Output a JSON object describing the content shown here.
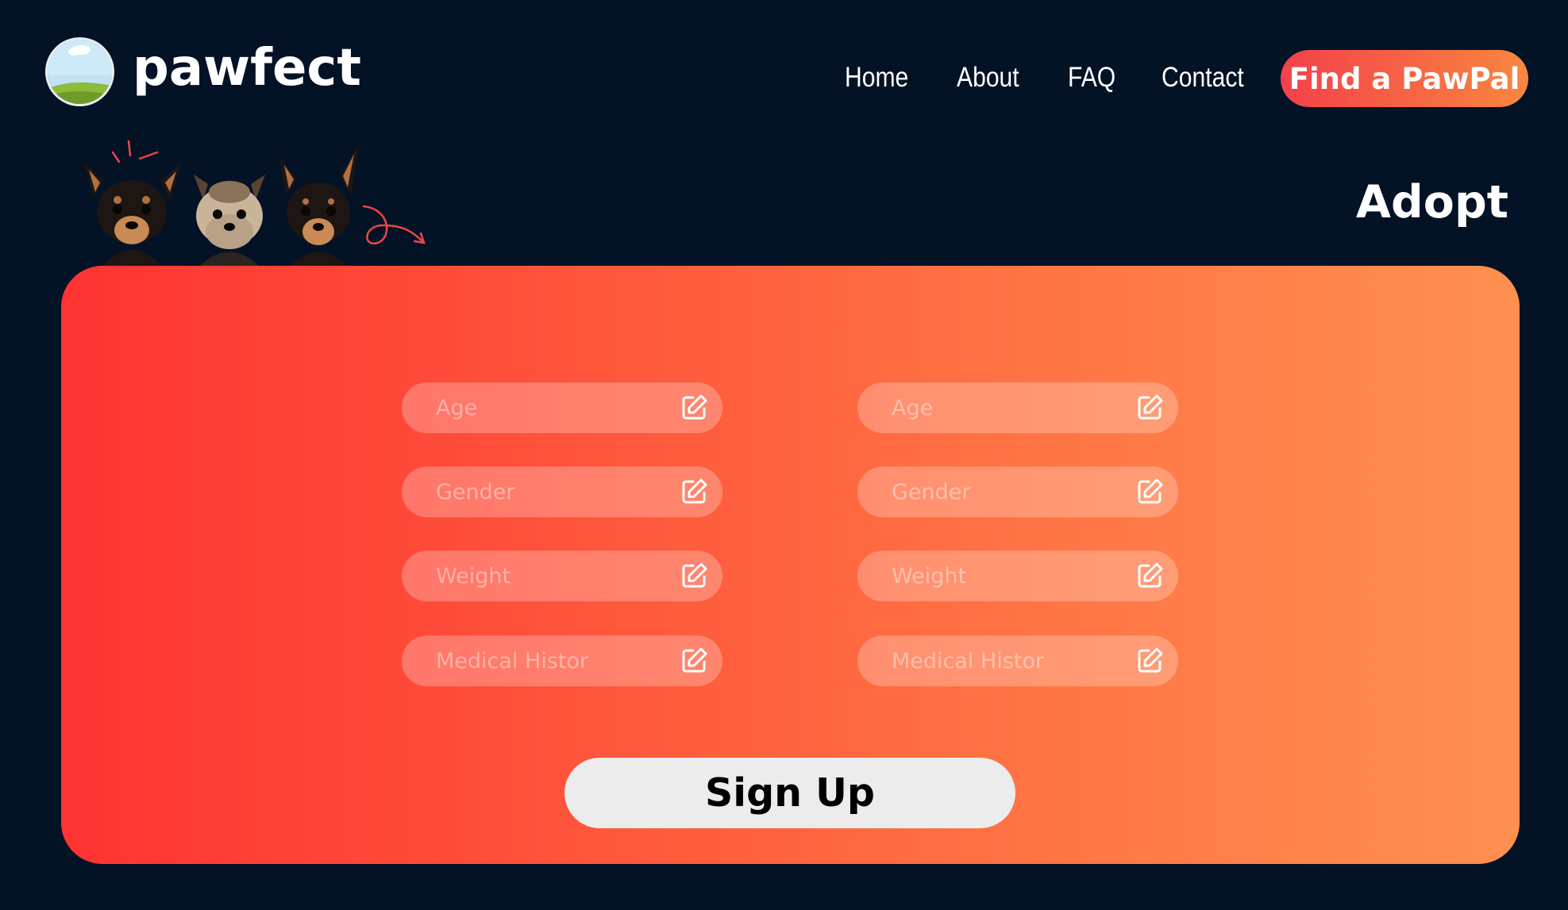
{
  "brand": {
    "name": "pawfect"
  },
  "nav": {
    "links": [
      "Home",
      "About",
      "FAQ",
      "Contact"
    ],
    "cta_label": "Find a PawPal"
  },
  "page": {
    "heading": "Adopt"
  },
  "form": {
    "columns": [
      {
        "fields": [
          {
            "placeholder": "Age",
            "value": ""
          },
          {
            "placeholder": "Gender",
            "value": ""
          },
          {
            "placeholder": "Weight",
            "value": ""
          },
          {
            "placeholder": "Medical Histor",
            "value": ""
          }
        ]
      },
      {
        "fields": [
          {
            "placeholder": "Age",
            "value": ""
          },
          {
            "placeholder": "Gender",
            "value": ""
          },
          {
            "placeholder": "Weight",
            "value": ""
          },
          {
            "placeholder": "Medical Histor",
            "value": ""
          }
        ]
      }
    ],
    "submit_label": "Sign Up"
  },
  "icons": {
    "field_action": "edit-icon",
    "logo": "landscape-icon"
  },
  "colors": {
    "background": "#041226",
    "panel_gradient_start": "#ff3333",
    "panel_gradient_end": "#ff9050",
    "cta_gradient_start": "#f4404a",
    "cta_gradient_end": "#f8873f",
    "submit_background": "#ececec"
  }
}
